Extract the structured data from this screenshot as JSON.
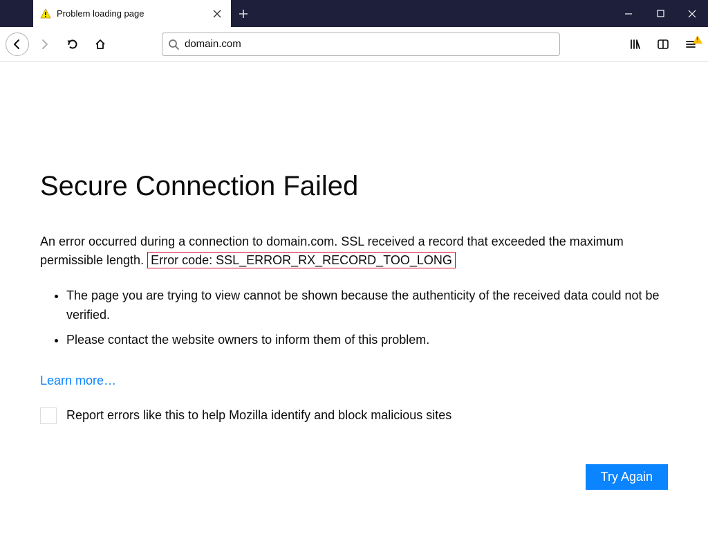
{
  "window": {
    "tab_title": "Problem loading page"
  },
  "urlbar": {
    "value": "domain.com"
  },
  "page": {
    "heading": "Secure Connection Failed",
    "description_pre": "An error occurred during a connection to domain.com. SSL received a record that exceeded the maximum permissible length. ",
    "error_code": "Error code: SSL_ERROR_RX_RECORD_TOO_LONG",
    "bullets": [
      "The page you are trying to view cannot be shown because the authenticity of the received data could not be verified.",
      "Please contact the website owners to inform them of this problem."
    ],
    "learn_more": "Learn more…",
    "report_label": "Report errors like this to help Mozilla identify and block malicious sites",
    "try_again": "Try Again"
  }
}
